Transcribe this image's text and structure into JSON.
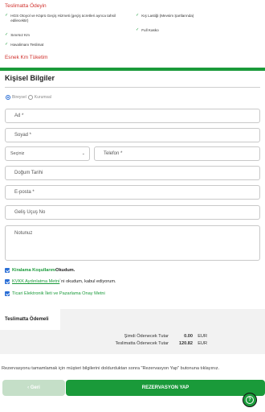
{
  "top": {
    "pay_title": "Teslimatta Ödeyin",
    "features": [
      "HGS Otoyol ve Köprü Geçiş Hizmeti (geçiş ücretleri ayrıca tahsil edilecektir)",
      "Kış Lastiği (Mevsim Şartlarında)",
      "Full Kasko",
      "Sınırsız Km",
      "Havalimanı Teslimat"
    ],
    "km_link": "Esnek Km Tüketim"
  },
  "personal": {
    "title": "Kişisel Bilgiler",
    "radio_individual": "Bireysel",
    "radio_corporate": "Kurumsal",
    "first_name": "Ad *",
    "last_name": "Soyad *",
    "country_select": "Seçiniz",
    "phone": "Telefon *",
    "birth_date": "Doğum Tarihi",
    "email": "E-posta *",
    "flight_no": "Geliş Uçuş No",
    "notes": "Notunuz"
  },
  "consents": {
    "rental_terms_link": "Kiralama Koşullarını",
    "rental_terms_suffix": " Okudum.",
    "kvkk_link": "KVKK Aydınlatma Metni",
    "kvkk_suffix": "`ni okudum, kabul ediyorum.",
    "marketing_link": "Ticari Elektronik İleti ve Pazarlama Onay Metni"
  },
  "payment": {
    "title": "Teslimatta Ödemeli",
    "now_label": "Şimdi Ödenecek Tutar",
    "now_value": "0.00",
    "now_currency": "EUR",
    "delivery_label": "Teslimatta Ödenecek Tutar",
    "delivery_value": "120.82",
    "delivery_currency": "EUR"
  },
  "info_text": "Rezervasyonu tamamlamak için müşteri bilgilerini doldurduktan sonra \"Rezervasyon Yap\" butonuna tıklayınız.",
  "buttons": {
    "back": "‹ Geri",
    "reserve": "REZERVASYON YAP"
  },
  "colors": {
    "brand_green": "#1a9a3a",
    "accent_red": "#d0312d",
    "checkbox_blue": "#2b6fd6"
  }
}
